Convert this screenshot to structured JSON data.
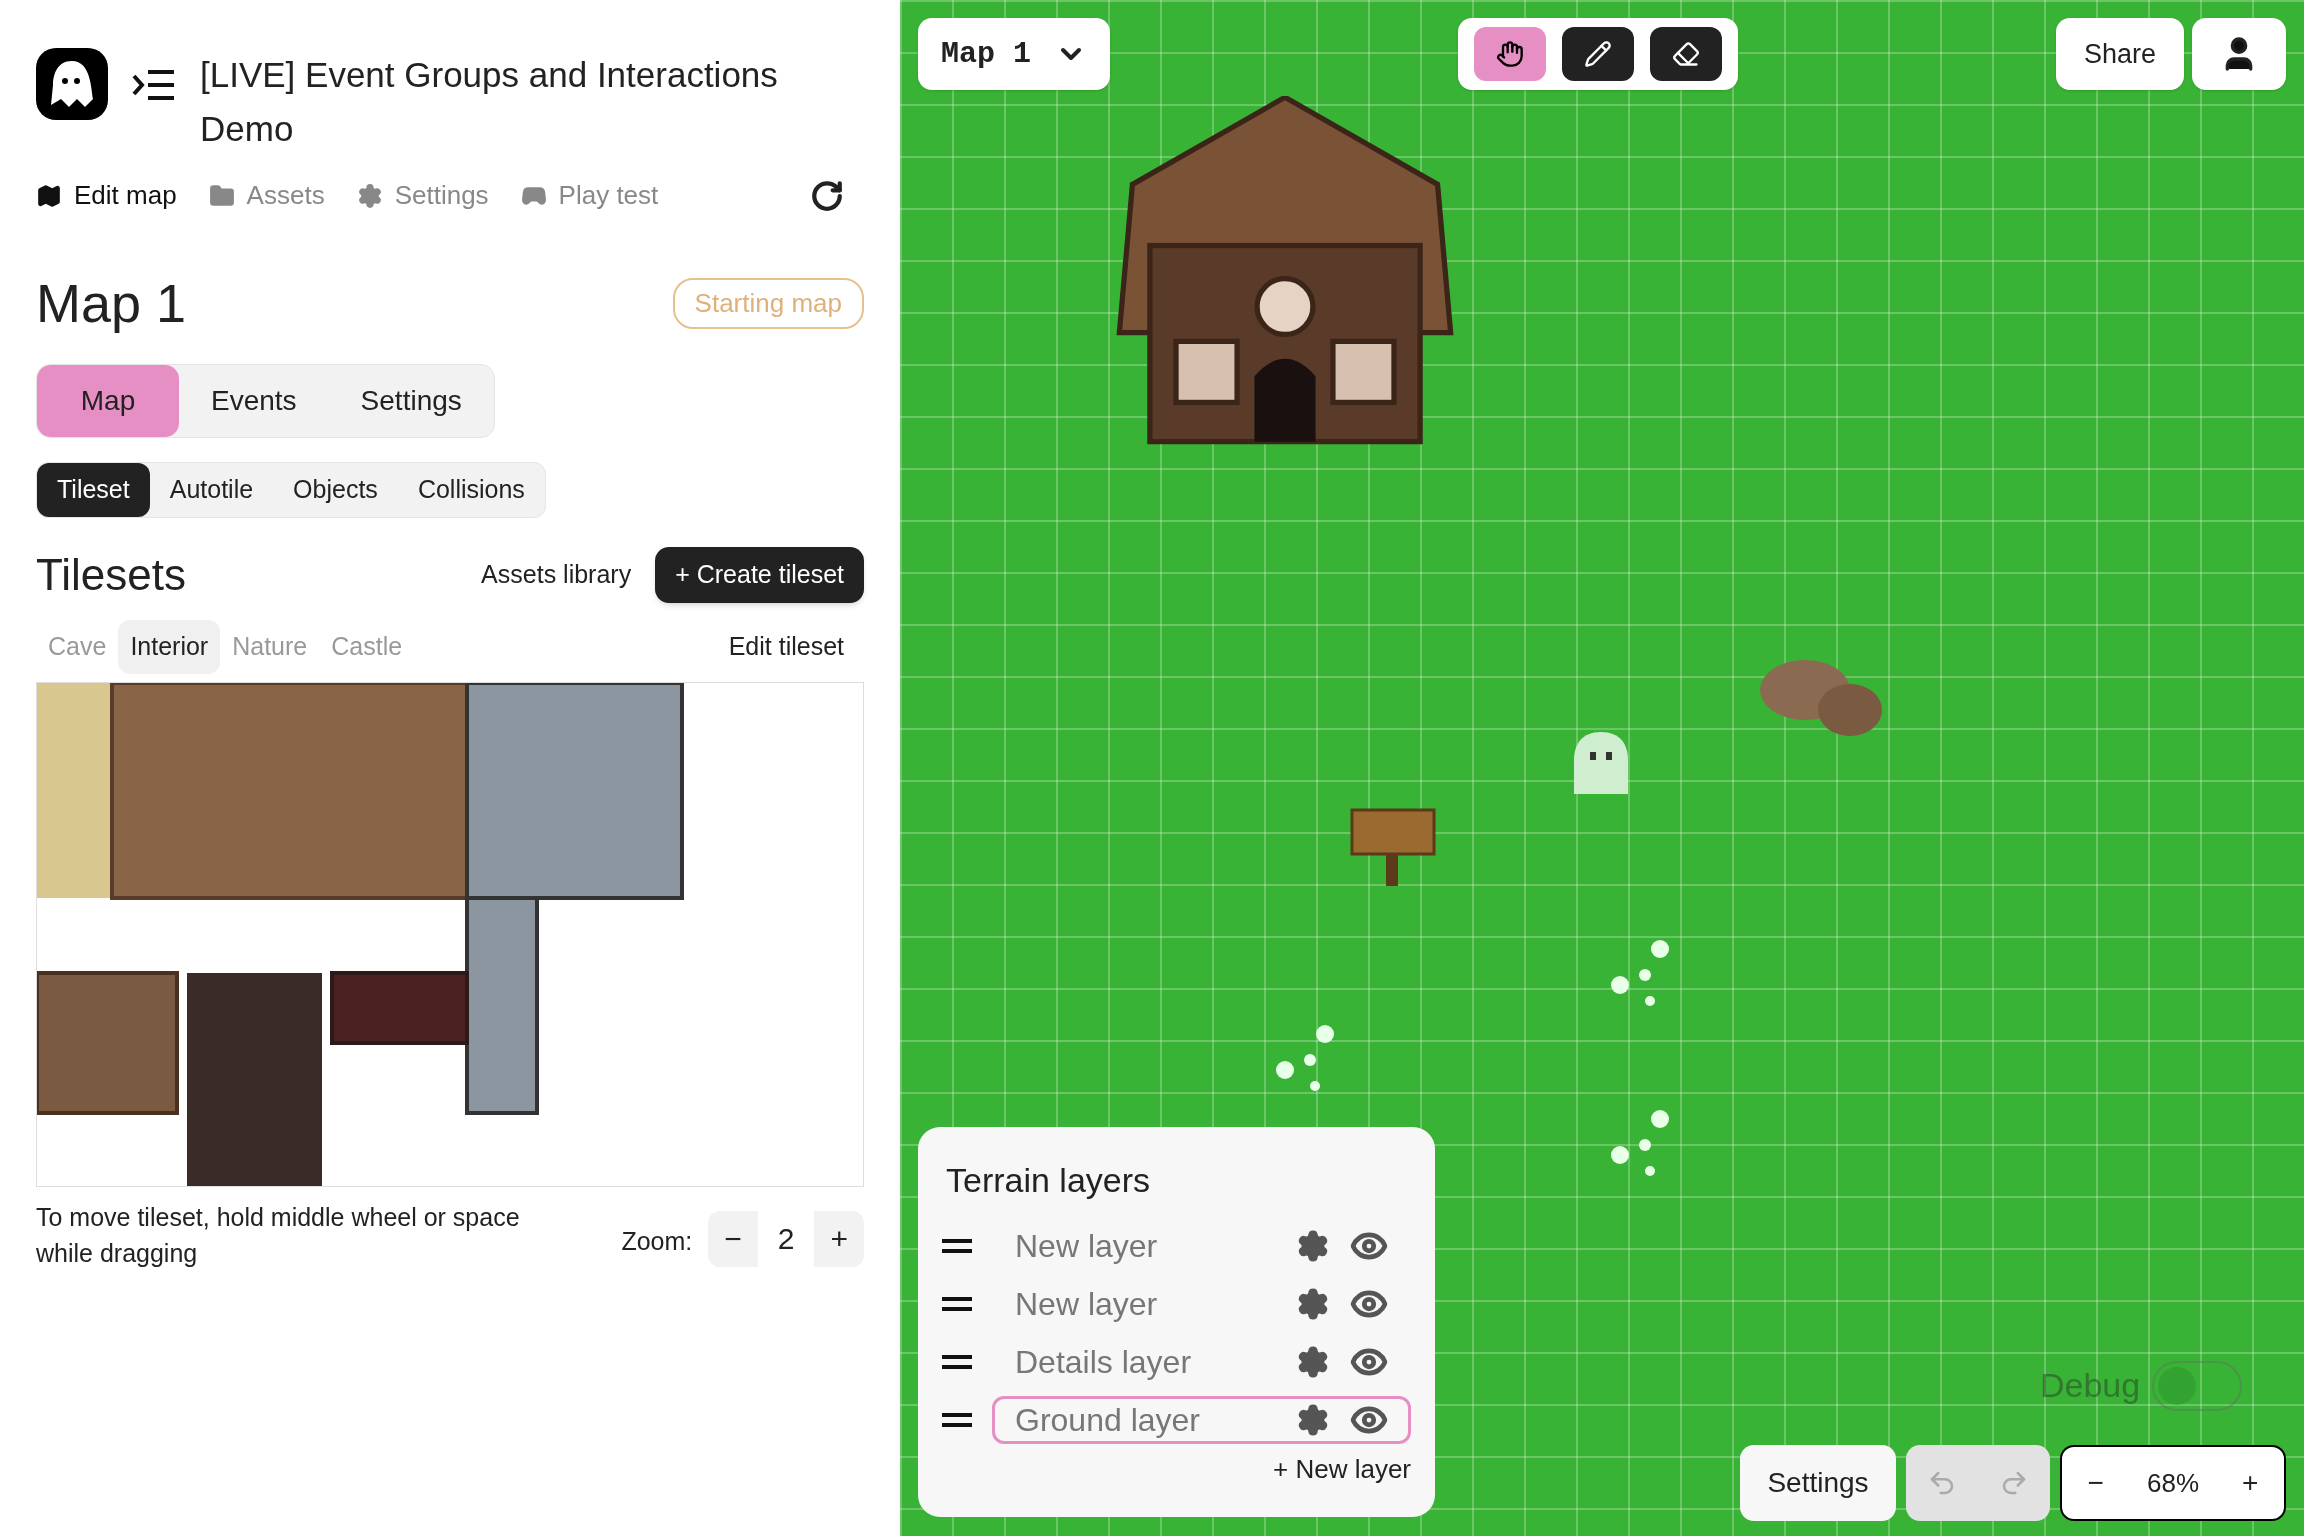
{
  "header": {
    "title": "[LIVE] Event Groups and Interactions Demo"
  },
  "nav": [
    {
      "label": "Edit map",
      "selected": true
    },
    {
      "label": "Assets",
      "selected": false
    },
    {
      "label": "Settings",
      "selected": false
    },
    {
      "label": "Play test",
      "selected": false
    }
  ],
  "map_title": "Map 1",
  "starting_badge": "Starting map",
  "tabs": [
    {
      "label": "Map",
      "selected": true
    },
    {
      "label": "Events",
      "selected": false
    },
    {
      "label": "Settings",
      "selected": false
    }
  ],
  "subtabs": [
    {
      "label": "Tileset",
      "selected": true
    },
    {
      "label": "Autotile",
      "selected": false
    },
    {
      "label": "Objects",
      "selected": false
    },
    {
      "label": "Collisions",
      "selected": false
    }
  ],
  "tilesets": {
    "title": "Tilesets",
    "assets_link": "Assets library",
    "create_button": "+ Create tileset",
    "edit_button": "Edit tileset",
    "tabs": [
      {
        "label": "Cave",
        "selected": false
      },
      {
        "label": "Interior",
        "selected": true
      },
      {
        "label": "Nature",
        "selected": false
      },
      {
        "label": "Castle",
        "selected": false
      }
    ]
  },
  "help_text": "To move tileset, hold middle wheel or space while dragging",
  "zoom": {
    "label": "Zoom:",
    "minus": "−",
    "value": "2",
    "plus": "+"
  },
  "map_selector": "Map 1",
  "tools": [
    {
      "selected": true
    },
    {
      "selected": false
    },
    {
      "selected": false
    }
  ],
  "share": "Share",
  "terrain": {
    "title": "Terrain layers",
    "add": "+ New layer",
    "layers": [
      {
        "name": "New layer",
        "selected": false
      },
      {
        "name": "New layer",
        "selected": false
      },
      {
        "name": "Details layer",
        "selected": false
      },
      {
        "name": "Ground layer",
        "selected": true
      }
    ]
  },
  "debug": {
    "label": "Debug",
    "on": false
  },
  "bottom_settings": "Settings",
  "map_zoom": {
    "minus": "−",
    "value": "68%",
    "plus": "+"
  }
}
